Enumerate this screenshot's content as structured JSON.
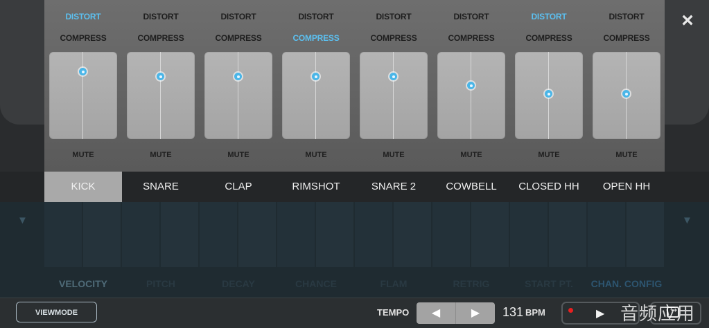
{
  "close_label": "×",
  "channels": [
    {
      "name": "KICK",
      "distort": "DISTORT",
      "compress": "COMPRESS",
      "mute": "MUTE",
      "distort_active": true,
      "compress_active": false,
      "level": 0.78
    },
    {
      "name": "SNARE",
      "distort": "DISTORT",
      "compress": "COMPRESS",
      "mute": "MUTE",
      "distort_active": false,
      "compress_active": false,
      "level": 0.72
    },
    {
      "name": "CLAP",
      "distort": "DISTORT",
      "compress": "COMPRESS",
      "mute": "MUTE",
      "distort_active": false,
      "compress_active": false,
      "level": 0.72
    },
    {
      "name": "RIMSHOT",
      "distort": "DISTORT",
      "compress": "COMPRESS",
      "mute": "MUTE",
      "distort_active": false,
      "compress_active": true,
      "level": 0.72
    },
    {
      "name": "SNARE 2",
      "distort": "DISTORT",
      "compress": "COMPRESS",
      "mute": "MUTE",
      "distort_active": false,
      "compress_active": false,
      "level": 0.72
    },
    {
      "name": "COWBELL",
      "distort": "DISTORT",
      "compress": "COMPRESS",
      "mute": "MUTE",
      "distort_active": false,
      "compress_active": false,
      "level": 0.62
    },
    {
      "name": "CLOSED HH",
      "distort": "DISTORT",
      "compress": "COMPRESS",
      "mute": "MUTE",
      "distort_active": true,
      "compress_active": false,
      "level": 0.52
    },
    {
      "name": "OPEN HH",
      "distort": "DISTORT",
      "compress": "COMPRESS",
      "mute": "MUTE",
      "distort_active": false,
      "compress_active": false,
      "level": 0.52
    }
  ],
  "selected_channel": "KICK",
  "params": [
    "VELOCITY",
    "PITCH",
    "DECAY",
    "CHANCE",
    "FLAM",
    "RETRIG",
    "START PT.",
    "CHAN. CONFIG"
  ],
  "transport": {
    "viewmode": "VIEWMODE",
    "tempo_label": "TEMPO",
    "tempo_dec": "◀",
    "tempo_inc": "▶",
    "bpm": "131",
    "bpm_unit": "BPM",
    "play": "▶"
  },
  "scroll_left": "▼",
  "scroll_right": "▼",
  "watermark": "音频应用",
  "colors": {
    "accent": "#5cc0f0",
    "knob": "#4ab6e8",
    "record": "#e82020"
  }
}
